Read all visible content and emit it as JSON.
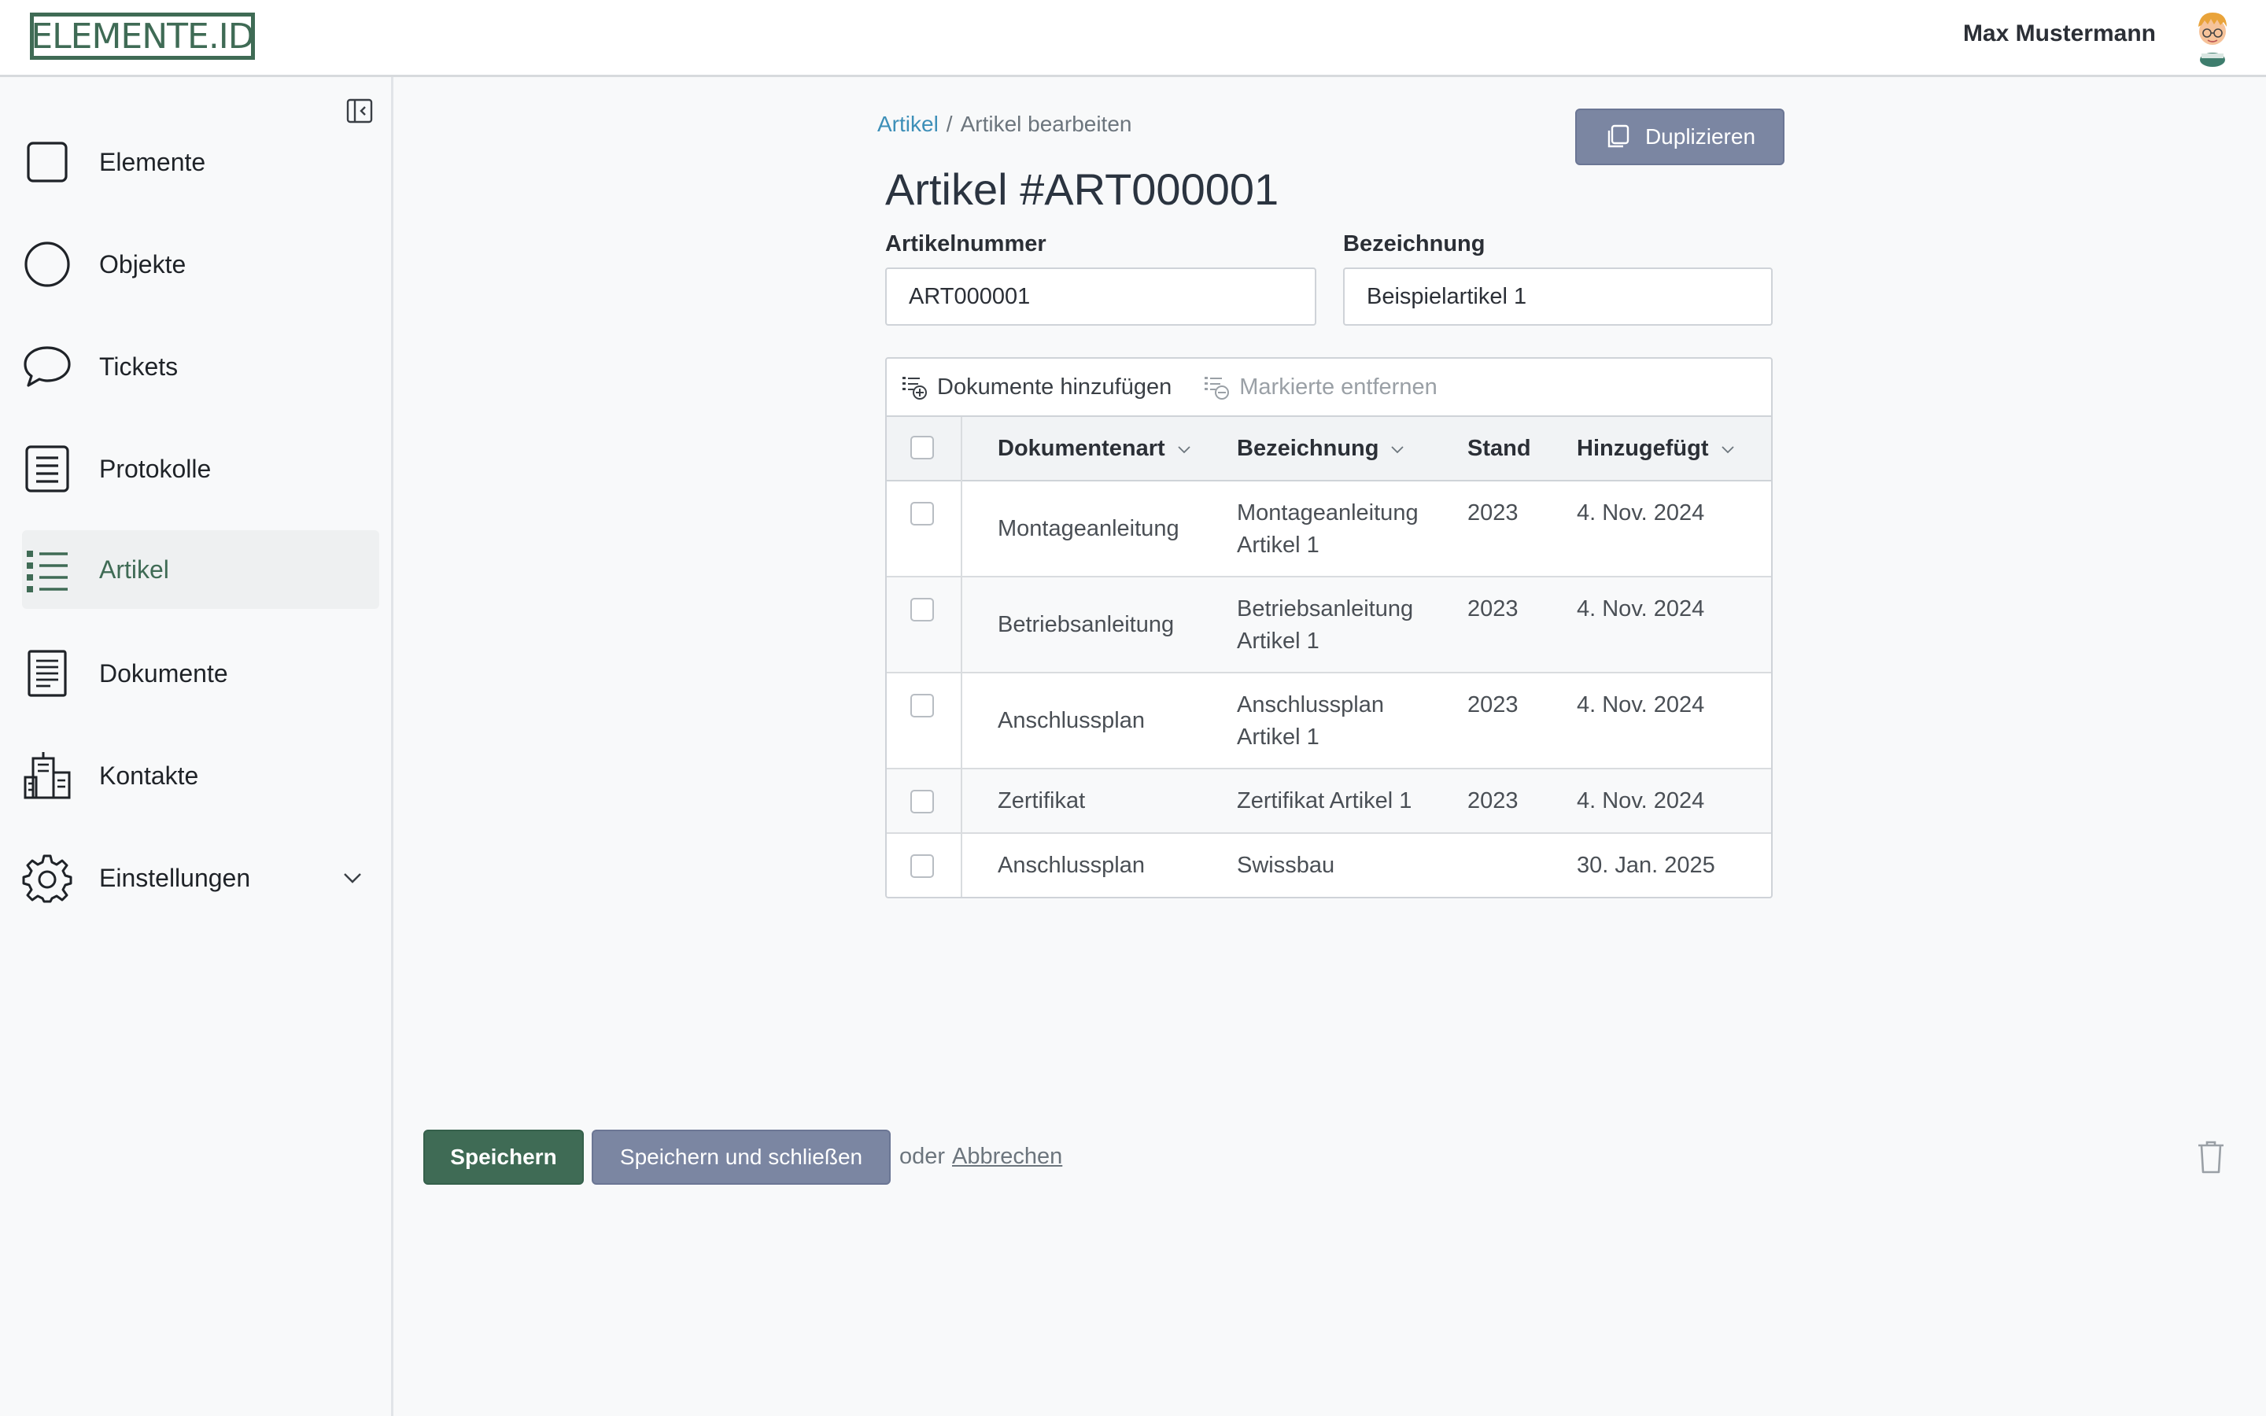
{
  "header": {
    "logo_text": "ELEMENTE.ID",
    "user_name": "Max Mustermann"
  },
  "sidebar": {
    "items": [
      {
        "label": "Elemente",
        "icon": "square-icon"
      },
      {
        "label": "Objekte",
        "icon": "circle-icon"
      },
      {
        "label": "Tickets",
        "icon": "speech-bubble-icon"
      },
      {
        "label": "Protokolle",
        "icon": "list-document-icon"
      },
      {
        "label": "Artikel",
        "icon": "bulleted-list-icon",
        "active": true
      },
      {
        "label": "Dokumente",
        "icon": "document-icon"
      },
      {
        "label": "Kontakte",
        "icon": "buildings-icon"
      },
      {
        "label": "Einstellungen",
        "icon": "gear-icon",
        "expandable": true
      }
    ]
  },
  "breadcrumb": {
    "parent": "Artikel",
    "separator": "/",
    "current": "Artikel bearbeiten"
  },
  "duplicate_label": "Duplizieren",
  "page_title": "Artikel #ART000001",
  "form": {
    "article_number_label": "Artikelnummer",
    "article_number_value": "ART000001",
    "designation_label": "Bezeichnung",
    "designation_value": "Beispielartikel 1"
  },
  "documents": {
    "add_label": "Dokumente hinzufügen",
    "remove_label": "Markierte entfernen",
    "columns": [
      "Dokumentenart",
      "Bezeichnung",
      "Stand",
      "Hinzugefügt"
    ],
    "rows": [
      {
        "type": "Montageanleitung",
        "name_line1": "Montageanleitung",
        "name_line2": "Artikel 1",
        "stand": "2023",
        "added": "4. Nov. 2024"
      },
      {
        "type": "Betriebsanleitung",
        "name_line1": "Betriebsanleitung",
        "name_line2": "Artikel 1",
        "stand": "2023",
        "added": "4. Nov. 2024"
      },
      {
        "type": "Anschlussplan",
        "name_line1": "Anschlussplan",
        "name_line2": "Artikel 1",
        "stand": "2023",
        "added": "4. Nov. 2024"
      },
      {
        "type": "Zertifikat",
        "name_line1": "Zertifikat Artikel 1",
        "name_line2": "",
        "stand": "2023",
        "added": "4. Nov. 2024"
      },
      {
        "type": "Anschlussplan",
        "name_line1": "Swissbau",
        "name_line2": "",
        "stand": "",
        "added": "30. Jan. 2025"
      }
    ]
  },
  "actions": {
    "save": "Speichern",
    "save_close": "Speichern und schließen",
    "or": "oder",
    "cancel": "Abbrechen"
  },
  "colors": {
    "brand": "#3f6b55",
    "secondary_button": "#7b86a2",
    "link": "#3d8fb8"
  }
}
